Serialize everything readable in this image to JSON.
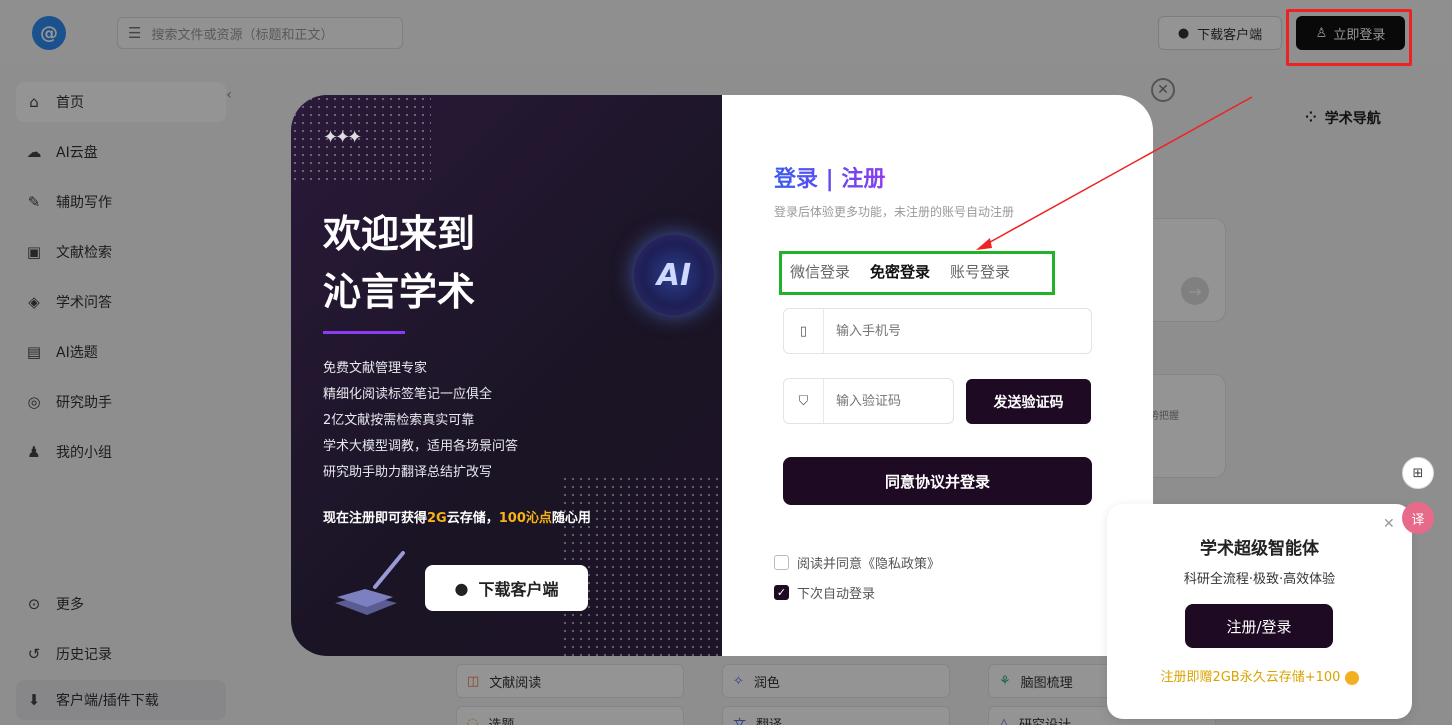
{
  "topbar": {
    "logo": "@",
    "search_placeholder": "搜索文件或资源（标题和正文）",
    "download_label": "下载客户端",
    "login_label": "立即登录"
  },
  "sidebar": {
    "items": [
      {
        "label": "首页",
        "icon": "home-icon"
      },
      {
        "label": "AI云盘",
        "icon": "cloud-icon"
      },
      {
        "label": "辅助写作",
        "icon": "pen-icon"
      },
      {
        "label": "文献检索",
        "icon": "doc-search-icon"
      },
      {
        "label": "学术问答",
        "icon": "qa-icon"
      },
      {
        "label": "AI选题",
        "icon": "topic-icon"
      },
      {
        "label": "研究助手",
        "icon": "assistant-icon"
      },
      {
        "label": "我的小组",
        "icon": "group-icon"
      }
    ],
    "bottom": [
      {
        "label": "更多",
        "icon": "more-icon"
      },
      {
        "label": "历史记录",
        "icon": "history-icon"
      },
      {
        "label": "客户端/插件下载",
        "icon": "download-icon"
      }
    ]
  },
  "background": {
    "nav_label": "学术导航",
    "tools": [
      "文献阅读",
      "润色",
      "脑图梳理",
      "选题",
      "翻译",
      "研究设计"
    ],
    "card_text": "趋势把握"
  },
  "modal": {
    "welcome_line1": "欢迎来到",
    "welcome_line2": "沁言学术",
    "features": [
      "免费文献管理专家",
      "精细化阅读标签笔记一应俱全",
      "2亿文献按需检索真实可靠",
      "学术大模型调教，适用各场景问答",
      "研究助手助力翻译总结扩改写"
    ],
    "promo_prefix": "现在注册即可获得",
    "promo_storage": "2G",
    "promo_mid": "云存储，",
    "promo_points": "100沁点",
    "promo_suffix": "随心用",
    "ai_badge": "AI",
    "download_label": "下载客户端",
    "form_title": "登录 | 注册",
    "form_subtitle": "登录后体验更多功能，未注册的账号自动注册",
    "tabs": [
      "微信登录",
      "免密登录",
      "账号登录"
    ],
    "active_tab": "免密登录",
    "phone_placeholder": "输入手机号",
    "code_placeholder": "输入验证码",
    "send_code_label": "发送验证码",
    "submit_label": "同意协议并登录",
    "privacy_text": "阅读并同意《隐私政策》",
    "privacy_checked": false,
    "auto_login_text": "下次自动登录",
    "auto_login_checked": true
  },
  "agent_card": {
    "title": "学术超级智能体",
    "subtitle": "科研全流程·极致·高效体验",
    "button_label": "注册/登录",
    "gift_text": "注册即赠2GB永久云存储+100"
  },
  "colors": {
    "accent_dark": "#1f0a24",
    "highlight_red": "#e22222",
    "highlight_green": "#22b22a",
    "promo_gold": "#f6b318"
  }
}
